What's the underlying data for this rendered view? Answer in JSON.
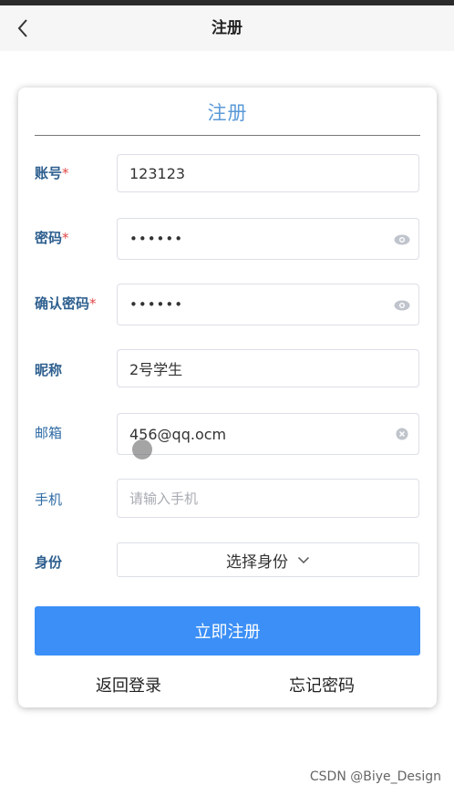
{
  "navbar": {
    "title": "注册",
    "back_icon": "chevron-left-icon"
  },
  "form": {
    "title": "注册",
    "required_mark": "*",
    "account": {
      "label": "账号",
      "required": true,
      "value": "123123"
    },
    "password": {
      "label": "密码",
      "required": true,
      "value": "••••••",
      "icon": "eye-icon"
    },
    "confirm_password": {
      "label": "确认密码",
      "required": true,
      "value": "••••••",
      "icon": "eye-icon"
    },
    "nickname": {
      "label": "昵称",
      "value": "2号学生"
    },
    "email": {
      "label": "邮箱",
      "value": "456@qq.ocm",
      "icon": "clear-icon"
    },
    "phone": {
      "label": "手机",
      "value": "",
      "placeholder": "请输入手机"
    },
    "identity": {
      "label": "身份",
      "selected": "选择身份",
      "icon": "chevron-down-icon"
    },
    "submit_label": "立即注册",
    "back_to_login": "返回登录",
    "forgot_password": "忘记密码"
  },
  "watermark": "CSDN @Biye_Design",
  "colors": {
    "primary": "#3b8ff6",
    "title_blue": "#5a9ad8",
    "label_blue": "#2e5f8f",
    "required_red": "#e04848"
  }
}
